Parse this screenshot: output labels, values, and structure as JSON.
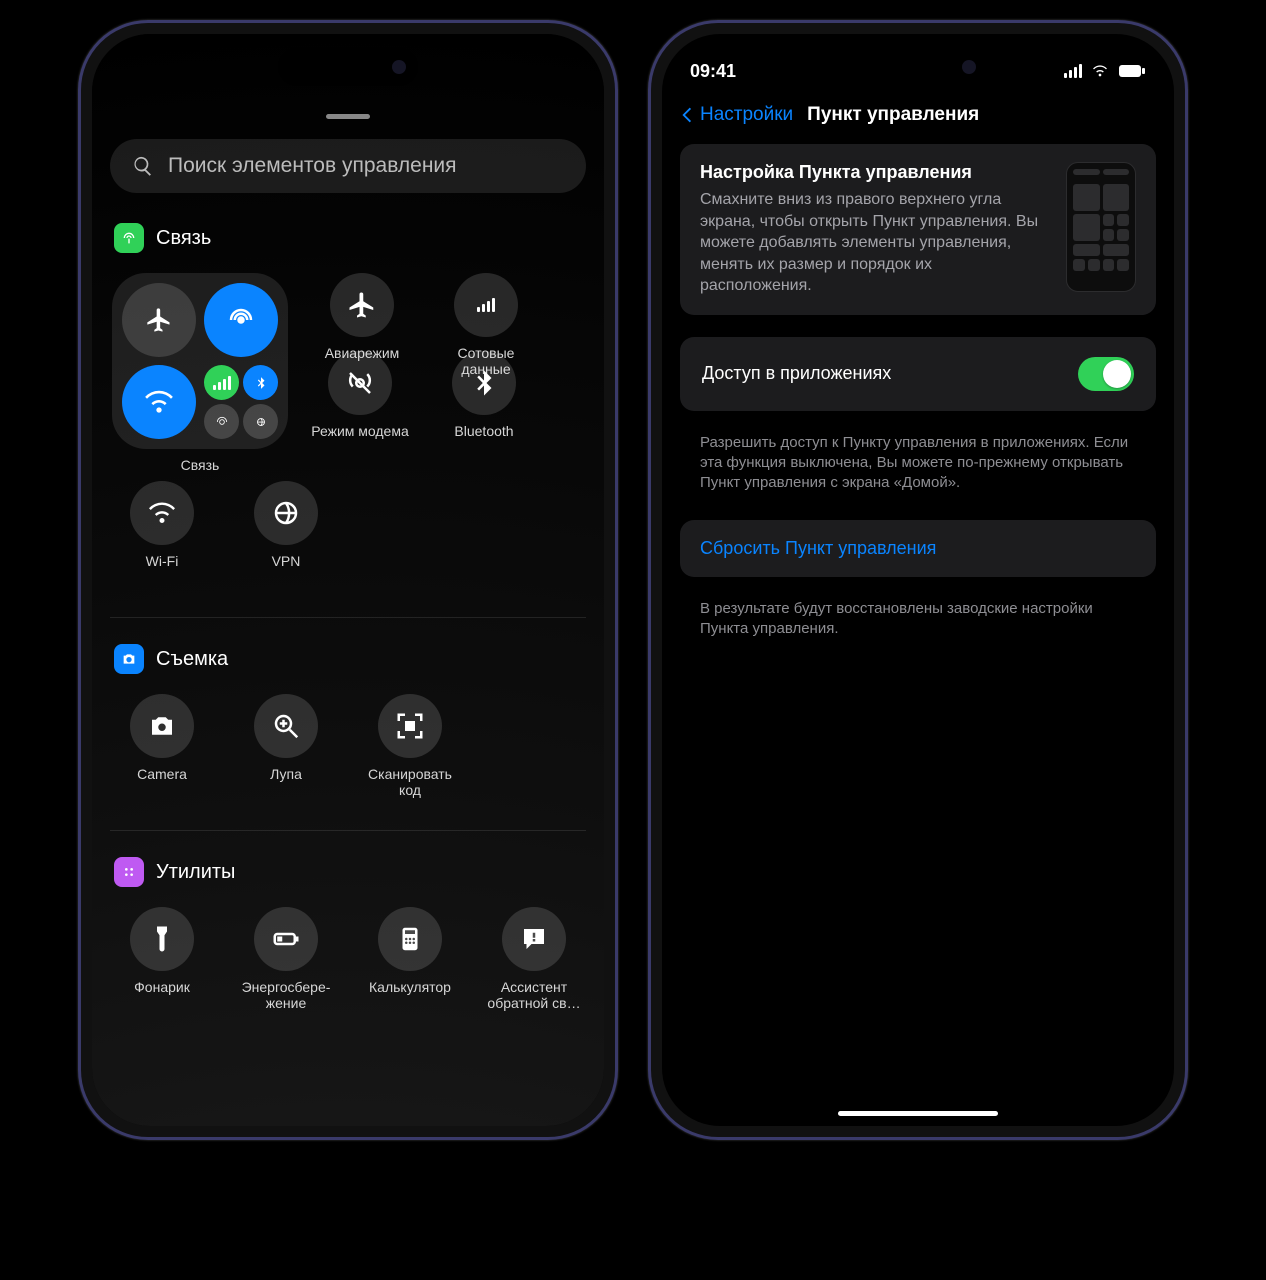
{
  "left": {
    "search_placeholder": "Поиск элементов управления",
    "sections": {
      "connectivity": {
        "title": "Связь",
        "card_label": "Связь",
        "tiles": {
          "airplane": "Авиарежим",
          "cellular": "Сотовые данные",
          "hotspot": "Режим модема",
          "bluetooth": "Bluetooth",
          "wifi": "Wi-Fi",
          "vpn": "VPN"
        }
      },
      "capture": {
        "title": "Съемка",
        "tiles": {
          "camera": "Camera",
          "magnifier": "Лупа",
          "scan": "Сканировать код"
        }
      },
      "utilities": {
        "title": "Утилиты",
        "tiles": {
          "flashlight": "Фонарик",
          "lowpower": "Энергосбере­жение",
          "calculator": "Калькулятор",
          "siri": "Ассистент обратной св…"
        }
      }
    }
  },
  "right": {
    "status_time": "09:41",
    "back_label": "Настройки",
    "title": "Пункт управления",
    "intro_title": "Настройка Пункта управления",
    "intro_body": "Смахните вниз из правого верхнего угла экрана, чтобы открыть Пункт управления. Вы можете добавлять элементы управления, менять их размер и порядок их расположения.",
    "switch_label": "Доступ в приложениях",
    "switch_on": true,
    "switch_footnote": "Разрешить доступ к Пункту управления в приложе­ниях. Если эта функция выключена, Вы можете по-прежнему открывать Пункт управления с экрана «Домой».",
    "reset_label": "Сбросить Пункт управления",
    "reset_footnote": "В результате будут восстановлены заводские настройки Пункта управления."
  }
}
